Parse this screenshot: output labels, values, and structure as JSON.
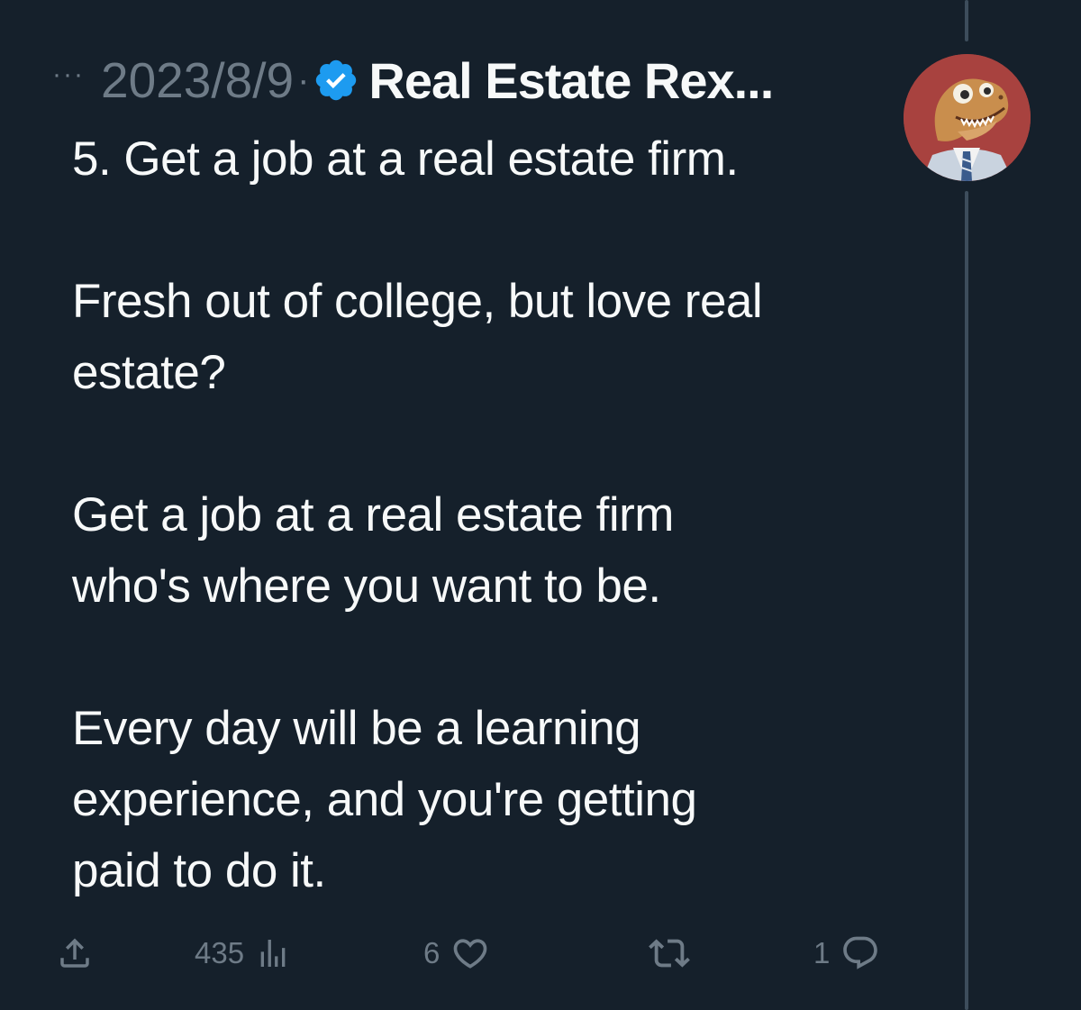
{
  "header": {
    "more_label": "···",
    "date": "2023/8/9",
    "separator": "·",
    "verified_icon": "verified-badge-icon",
    "author": "Real Estate Rex..."
  },
  "tweet": {
    "paragraphs": [
      [
        "5. Get a job at a real estate firm."
      ],
      [
        "Fresh out of college, but love real",
        "estate?"
      ],
      [
        "Get a job at a real estate firm",
        "who's where you want to be."
      ],
      [
        "Every day will be a learning",
        "experience, and you're getting",
        "paid to do it."
      ]
    ]
  },
  "actions": {
    "share_icon": "share-icon",
    "views": "435",
    "views_icon": "views-chart-icon",
    "likes": "6",
    "likes_icon": "heart-icon",
    "retweets_icon": "retweet-icon",
    "replies": "1",
    "replies_icon": "reply-icon"
  },
  "colors": {
    "background": "#15202b",
    "text": "#f7f9f9",
    "muted": "#6e7b87",
    "verified": "#1d9bf0",
    "avatar_bg": "#a8423f",
    "thread_line": "#3d4d5c"
  }
}
